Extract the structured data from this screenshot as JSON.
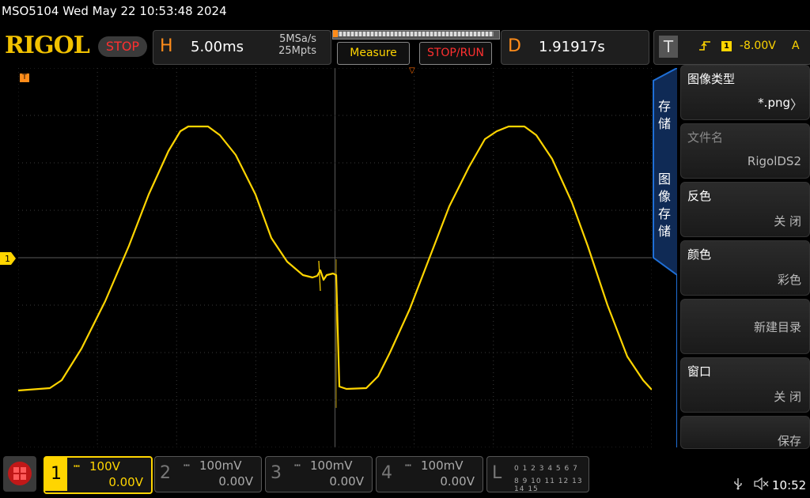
{
  "top_title": "MSO5104  Wed May 22 10:53:48 2024",
  "brand": "RIGOL",
  "run_state": "STOP",
  "horizontal": {
    "letter": "H",
    "timebase": "5.00ms",
    "sample_rate": "5MSa/s",
    "memory_depth": "25Mpts"
  },
  "buttons": {
    "measure": "Measure",
    "stop_run": "STOP/RUN"
  },
  "delay": {
    "letter": "D",
    "value": "1.91917s"
  },
  "trigger": {
    "letter": "T",
    "edge_icon": "rising-edge-icon",
    "source": "1",
    "level": "-8.00V",
    "mode": "A"
  },
  "markers": {
    "trigger_tag": "T",
    "ch1_tag": "1"
  },
  "side_tabs": {
    "save": "存\n储",
    "image_save": "图\n像\n存\n储"
  },
  "menu": [
    {
      "label": "图像类型",
      "value": "*.png",
      "enabled": true
    },
    {
      "label": "文件名",
      "value": "RigolDS2",
      "enabled": false
    },
    {
      "label": "反色",
      "value": "关 闭",
      "enabled": false
    },
    {
      "label": "颜色",
      "value": "彩色",
      "enabled": false
    },
    {
      "label": "",
      "value": "新建目录",
      "enabled": false
    },
    {
      "label": "窗口",
      "value": "关 闭",
      "enabled": false
    },
    {
      "label": "",
      "value": "保存",
      "enabled": false
    }
  ],
  "channels": [
    {
      "num": "1",
      "scale": "100V",
      "offset": "0.00V",
      "active": true
    },
    {
      "num": "2",
      "scale": "100mV",
      "offset": "0.00V",
      "active": false
    },
    {
      "num": "3",
      "scale": "100mV",
      "offset": "0.00V",
      "active": false
    },
    {
      "num": "4",
      "scale": "100mV",
      "offset": "0.00V",
      "active": false
    }
  ],
  "logic": {
    "letter": "L",
    "row1": "0 1 2 3  4 5 6 7",
    "row2": "8 9 10 11 12 13 14 15"
  },
  "status": {
    "clock": "10:52",
    "usb_icon": "usb-icon",
    "speaker_icon": "speaker-muted-icon"
  },
  "colors": {
    "ch1": "#ffd500",
    "accent": "#ff8c1a",
    "stop": "#ff3030",
    "menu_border": "#1f6fd6"
  }
}
